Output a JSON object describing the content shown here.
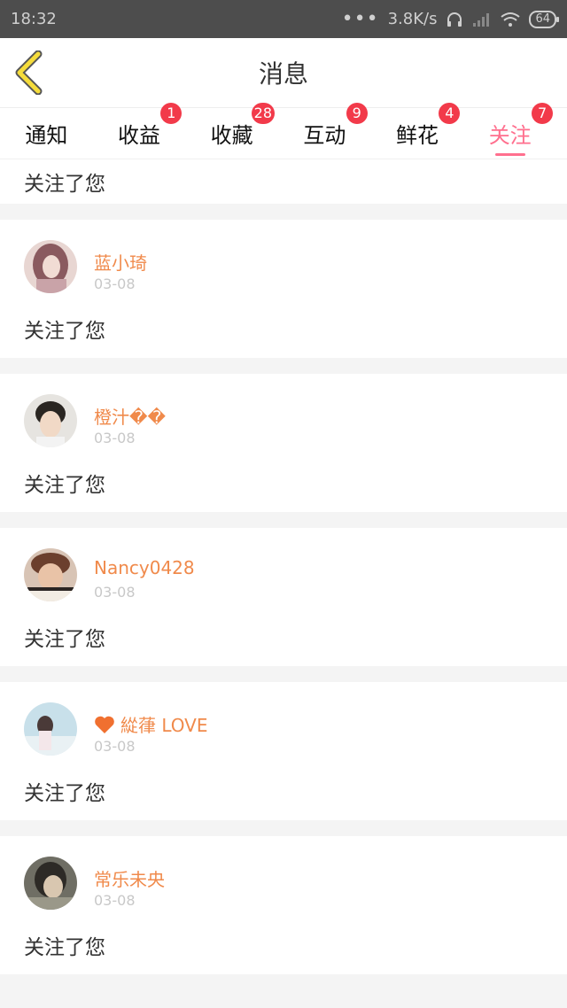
{
  "status": {
    "time": "18:32",
    "dots": "•••",
    "speed": "3.8K/s",
    "battery": "64"
  },
  "header": {
    "title": "消息"
  },
  "tabs": [
    {
      "label": "通知",
      "badge": ""
    },
    {
      "label": "收益",
      "badge": "1"
    },
    {
      "label": "收藏",
      "badge": "28"
    },
    {
      "label": "互动",
      "badge": "9"
    },
    {
      "label": "鲜花",
      "badge": "4"
    },
    {
      "label": "关注",
      "badge": "7",
      "active": true
    }
  ],
  "partial_message": "关注了您",
  "items": [
    {
      "name": "蓝小琦",
      "date": "03-08",
      "message": "关注了您",
      "avatar_color": "#c9a3a8"
    },
    {
      "name": "橙汁��",
      "date": "03-08",
      "message": "关注了您",
      "avatar_color": "#d8d0c8"
    },
    {
      "name": "Nancy0428",
      "date": "03-08",
      "message": "关注了您",
      "avatar_color": "#b98d79"
    },
    {
      "name": "緃葎 LOVE",
      "date": "03-08",
      "message": "关注了您",
      "avatar_color": "#9fc5d8"
    },
    {
      "name": "常乐未央",
      "date": "03-08",
      "message": "关注了您",
      "avatar_color": "#7b7a6e"
    }
  ],
  "colors": {
    "accent": "#ff6f8e",
    "name": "#f08a4b",
    "badge": "#f23a4a"
  }
}
